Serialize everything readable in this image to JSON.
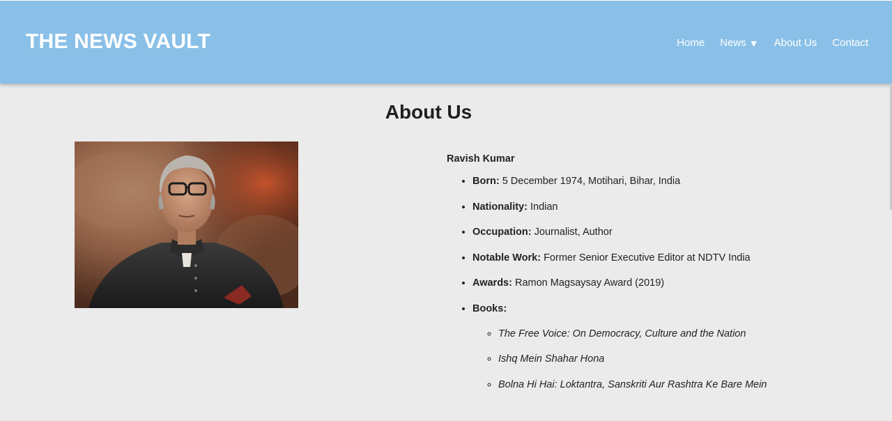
{
  "header": {
    "site_title": "THE NEWS VAULT",
    "nav": {
      "home": "Home",
      "news": "News",
      "news_caret": "▼",
      "about": "About Us",
      "contact": "Contact"
    },
    "background_color": "#8ac0e8"
  },
  "main": {
    "page_title": "About Us",
    "person": {
      "name": "Ravish Kumar",
      "photo_subject": "portrait-photo",
      "facts": [
        {
          "label": "Born:",
          "value": "5 December 1974, Motihari, Bihar, India"
        },
        {
          "label": "Nationality:",
          "value": "Indian"
        },
        {
          "label": "Occupation:",
          "value": "Journalist, Author"
        },
        {
          "label": "Notable Work:",
          "value": "Former Senior Executive Editor at NDTV India"
        },
        {
          "label": "Awards:",
          "value": "Ramon Magsaysay Award (2019)"
        },
        {
          "label": "Books:",
          "value": ""
        }
      ],
      "books": [
        "The Free Voice: On Democracy, Culture and the Nation",
        "Ishq Mein Shahar Hona",
        "Bolna Hi Hai: Loktantra, Sanskriti Aur Rashtra Ke Bare Mein"
      ]
    }
  }
}
